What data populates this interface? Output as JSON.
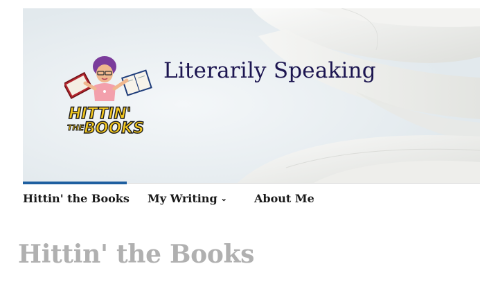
{
  "header": {
    "site_title": "Literarily Speaking",
    "logo": {
      "text_line1": "HITTIN'",
      "text_line2": "THE",
      "text_line3": "BOOKS"
    }
  },
  "nav": {
    "items": [
      {
        "label": "Hittin' the Books",
        "active": true
      },
      {
        "label": "My Writing",
        "has_dropdown": true
      },
      {
        "label": "About Me"
      }
    ],
    "accent_color": "#1e5fa0"
  },
  "page": {
    "title": "Hittin' the Books"
  }
}
